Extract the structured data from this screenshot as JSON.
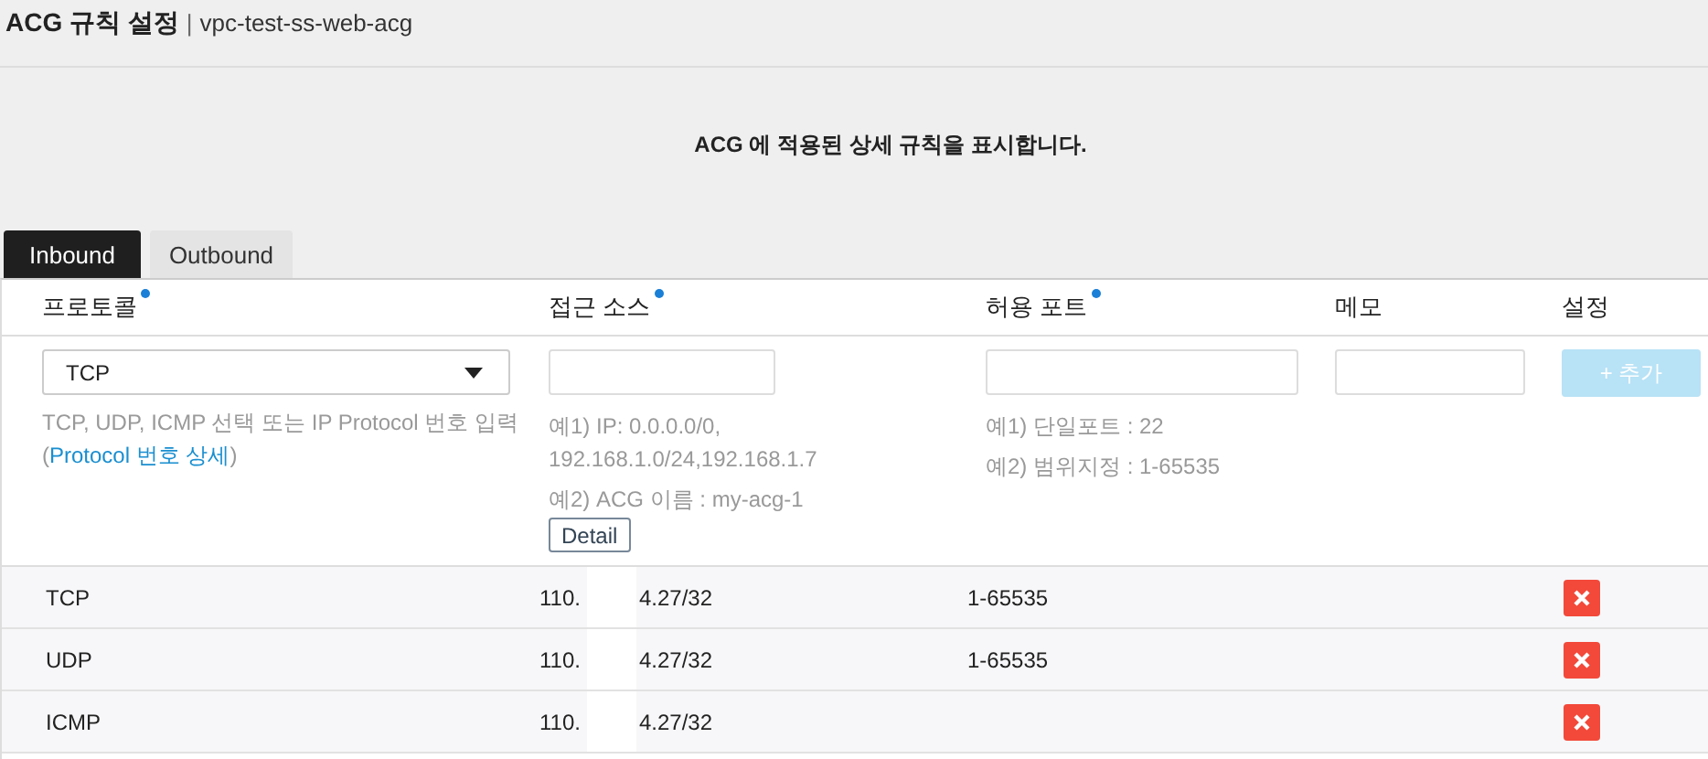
{
  "header": {
    "title": "ACG 규칙 설정",
    "separator": "|",
    "subtitle": "vpc-test-ss-web-acg"
  },
  "description": "ACG 에 적용된 상세 규칙을 표시합니다.",
  "tabs": [
    {
      "label": "Inbound",
      "selected": true
    },
    {
      "label": "Outbound",
      "selected": false
    }
  ],
  "columns": [
    {
      "label": "프로토콜",
      "required": true
    },
    {
      "label": "접근 소스",
      "required": true
    },
    {
      "label": "허용 포트",
      "required": true
    },
    {
      "label": "메모"
    },
    {
      "label": "설정"
    }
  ],
  "form": {
    "protocol": "TCP",
    "protocol_help": "TCP, UDP, ICMP 선택 또는 IP Protocol 번호 입력",
    "protocol_link_open": "(",
    "protocol_link": "Protocol 번호 상세",
    "protocol_link_close": ")",
    "source_help_1": "예1) IP: 0.0.0.0/0, 192.168.1.0/24,192.168.1.7",
    "source_help_2": "예2) ACG 이름 : my-acg-1",
    "detail_button": "Detail",
    "port_help_1": "예1) 단일포트 : 22",
    "port_help_2": "예2) 범위지정 : 1-65535",
    "add_button": "+ 추가",
    "add_disabled": true
  },
  "rows": [
    {
      "protocol": "TCP",
      "source_start": "110.",
      "source_end": "4.27/32",
      "port": "1-65535"
    },
    {
      "protocol": "UDP",
      "source_start": "110.",
      "source_end": "4.27/32",
      "port": "1-65535"
    },
    {
      "protocol": "ICMP",
      "source_start": "110.",
      "source_end": "4.27/32"
    }
  ]
}
